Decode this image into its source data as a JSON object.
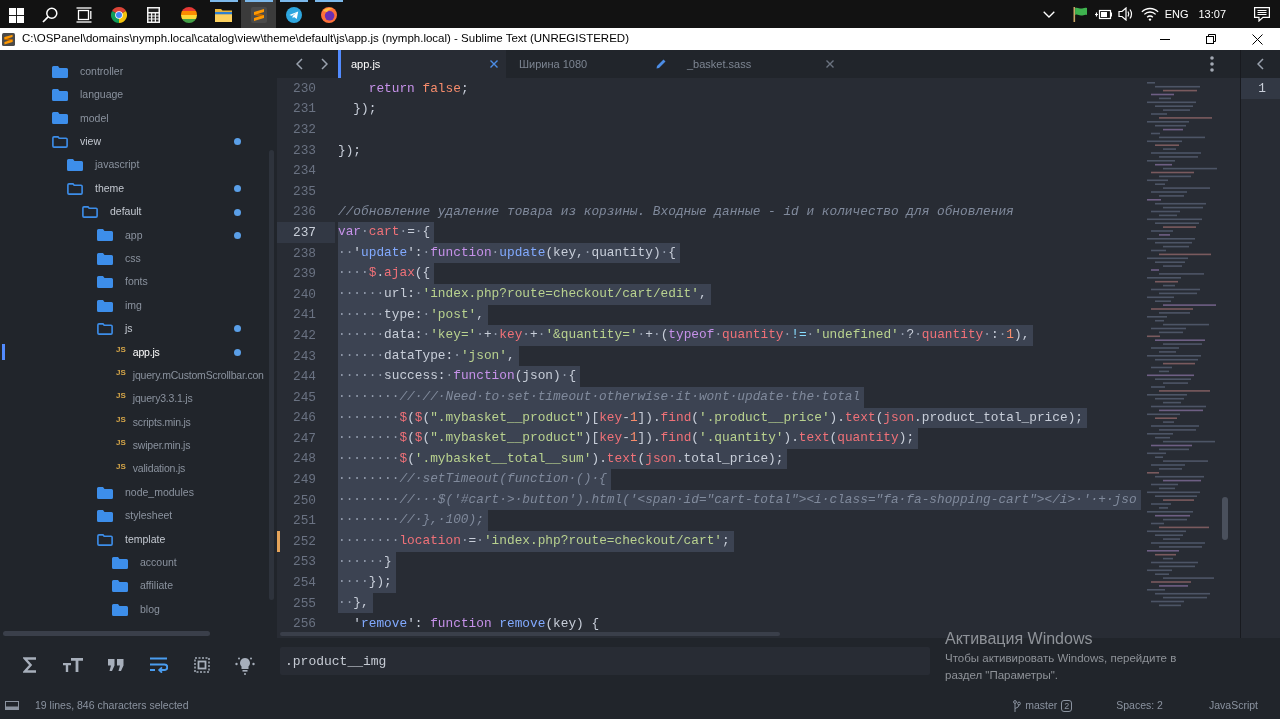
{
  "taskbar": {
    "apps": [
      {
        "kind": "start",
        "running": false,
        "active": false
      },
      {
        "kind": "search",
        "running": false,
        "active": false
      },
      {
        "kind": "task-view",
        "running": false,
        "active": false
      },
      {
        "kind": "color-wheel",
        "running": false,
        "active": false
      },
      {
        "kind": "calculator",
        "running": false,
        "active": false
      },
      {
        "kind": "striped-ball",
        "running": false,
        "active": false
      },
      {
        "kind": "folder",
        "running": true,
        "active": false
      },
      {
        "kind": "stripes-logo",
        "running": true,
        "active": true
      },
      {
        "kind": "paper-plane",
        "running": true,
        "active": false
      },
      {
        "kind": "globe",
        "running": true,
        "active": false
      }
    ],
    "language": "ENG",
    "time": "13:07"
  },
  "window": {
    "title": "C:\\OSPanel\\domains\\nymph.local\\catalog\\view\\theme\\default\\js\\app.js (nymph.local) - Sublime Text (UNREGISTERED)"
  },
  "sidebar": {
    "items": [
      {
        "kind": "folder",
        "label": "controller",
        "expanded": false,
        "modified": false,
        "selected": false
      },
      {
        "kind": "folder",
        "label": "language",
        "expanded": false,
        "modified": false,
        "selected": false
      },
      {
        "kind": "folder",
        "label": "model",
        "expanded": false,
        "modified": false,
        "selected": false
      },
      {
        "kind": "folder",
        "label": "view",
        "expanded": true,
        "modified": true,
        "selected": false,
        "children": [
          {
            "kind": "folder",
            "label": "javascript",
            "expanded": false,
            "modified": false,
            "selected": false
          },
          {
            "kind": "folder",
            "label": "theme",
            "expanded": true,
            "modified": true,
            "selected": false,
            "children": [
              {
                "kind": "folder",
                "label": "default",
                "expanded": true,
                "modified": true,
                "selected": false,
                "children": [
                  {
                    "kind": "folder",
                    "label": "app",
                    "expanded": false,
                    "modified": true,
                    "selected": false
                  },
                  {
                    "kind": "folder",
                    "label": "css",
                    "expanded": false,
                    "modified": false,
                    "selected": false
                  },
                  {
                    "kind": "folder",
                    "label": "fonts",
                    "expanded": false,
                    "modified": false,
                    "selected": false
                  },
                  {
                    "kind": "folder",
                    "label": "img",
                    "expanded": false,
                    "modified": false,
                    "selected": false
                  },
                  {
                    "kind": "folder",
                    "label": "js",
                    "expanded": true,
                    "modified": true,
                    "selected": false,
                    "children": [
                      {
                        "kind": "file",
                        "badge": "JS",
                        "label": "app.js",
                        "modified": true,
                        "selected": true
                      },
                      {
                        "kind": "file",
                        "badge": "JS",
                        "label": "jquery.mCustomScrollbar.con",
                        "modified": false,
                        "selected": false
                      },
                      {
                        "kind": "file",
                        "badge": "JS",
                        "label": "jquery3.3.1.js",
                        "modified": false,
                        "selected": false
                      },
                      {
                        "kind": "file",
                        "badge": "JS",
                        "label": "scripts.min.js",
                        "modified": false,
                        "selected": false
                      },
                      {
                        "kind": "file",
                        "badge": "JS",
                        "label": "swiper.min.js",
                        "modified": false,
                        "selected": false
                      },
                      {
                        "kind": "file",
                        "badge": "JS",
                        "label": "validation.js",
                        "modified": false,
                        "selected": false
                      }
                    ]
                  },
                  {
                    "kind": "folder",
                    "label": "node_modules",
                    "expanded": false,
                    "modified": false,
                    "selected": false
                  },
                  {
                    "kind": "folder",
                    "label": "stylesheet",
                    "expanded": false,
                    "modified": false,
                    "selected": false
                  },
                  {
                    "kind": "folder",
                    "label": "template",
                    "expanded": true,
                    "modified": false,
                    "selected": false,
                    "children": [
                      {
                        "kind": "folder",
                        "label": "account",
                        "expanded": false,
                        "modified": false,
                        "selected": false
                      },
                      {
                        "kind": "folder",
                        "label": "affiliate",
                        "expanded": false,
                        "modified": false,
                        "selected": false
                      },
                      {
                        "kind": "folder",
                        "label": "blog",
                        "expanded": false,
                        "modified": false,
                        "selected": false
                      }
                    ]
                  }
                ]
              }
            ]
          }
        ]
      }
    ]
  },
  "editor": {
    "tabs": [
      {
        "label": "app.js",
        "selected": true,
        "dirty": false
      },
      {
        "label": "Ширина 1080",
        "selected": false,
        "dirty": true
      },
      {
        "label": "_basket.sass",
        "selected": false,
        "dirty": false
      }
    ],
    "lines": [
      {
        "number": "230",
        "selected": false,
        "current": false,
        "changed": false,
        "tokens": [
          {
            "kind": "keyword",
            "text": "    return"
          },
          {
            "kind": "number",
            "text": " false"
          },
          {
            "kind": "plain",
            "text": ";"
          }
        ]
      },
      {
        "number": "231",
        "selected": false,
        "current": false,
        "changed": false,
        "tokens": [
          {
            "kind": "plain",
            "text": "  });"
          }
        ]
      },
      {
        "number": "232",
        "selected": false,
        "current": false,
        "changed": false
      },
      {
        "number": "233",
        "selected": false,
        "current": false,
        "changed": false,
        "tokens": [
          {
            "kind": "plain",
            "text": "});"
          }
        ]
      },
      {
        "number": "234",
        "selected": false,
        "current": false,
        "changed": false
      },
      {
        "number": "235",
        "selected": false,
        "current": false,
        "changed": false
      },
      {
        "number": "236",
        "selected": false,
        "current": false,
        "changed": false,
        "tokens": [
          {
            "kind": "comment",
            "text": "//обновление удаление товара из корзины. Входные данные - id и количество для обновления"
          }
        ]
      },
      {
        "number": "237",
        "selected": true,
        "current": true,
        "changed": false,
        "tokens": [
          {
            "kind": "keyword",
            "text": "var"
          },
          {
            "kind": "space",
            "text": "·"
          },
          {
            "kind": "variable",
            "text": "cart"
          },
          {
            "kind": "space",
            "text": "·"
          },
          {
            "kind": "plain",
            "text": "="
          },
          {
            "kind": "space",
            "text": "·"
          },
          {
            "kind": "plain",
            "text": "{"
          }
        ]
      },
      {
        "number": "238",
        "selected": true,
        "current": false,
        "changed": false,
        "tokens": [
          {
            "kind": "space",
            "text": "··"
          },
          {
            "kind": "plain",
            "text": "'"
          },
          {
            "kind": "key",
            "text": "update"
          },
          {
            "kind": "plain",
            "text": "':"
          },
          {
            "kind": "space",
            "text": "·"
          },
          {
            "kind": "keyword",
            "text": "function"
          },
          {
            "kind": "space",
            "text": "·"
          },
          {
            "kind": "function",
            "text": "update"
          },
          {
            "kind": "plain",
            "text": "(key,"
          },
          {
            "kind": "space",
            "text": "·"
          },
          {
            "kind": "plain",
            "text": "quantity)"
          },
          {
            "kind": "space",
            "text": "·"
          },
          {
            "kind": "plain",
            "text": "{"
          }
        ]
      },
      {
        "number": "239",
        "selected": true,
        "current": false,
        "changed": false,
        "tokens": [
          {
            "kind": "space",
            "text": "····"
          },
          {
            "kind": "variable",
            "text": "$"
          },
          {
            "kind": "plain",
            "text": "."
          },
          {
            "kind": "variable",
            "text": "ajax"
          },
          {
            "kind": "plain",
            "text": "({"
          }
        ]
      },
      {
        "number": "240",
        "selected": true,
        "current": false,
        "changed": false,
        "tokens": [
          {
            "kind": "space",
            "text": "······"
          },
          {
            "kind": "property",
            "text": "url"
          },
          {
            "kind": "plain",
            "text": ":"
          },
          {
            "kind": "space",
            "text": "·"
          },
          {
            "kind": "string",
            "text": "'index.php?route=checkout/cart/edit'"
          },
          {
            "kind": "plain",
            "text": ","
          }
        ]
      },
      {
        "number": "241",
        "selected": true,
        "current": false,
        "changed": false,
        "tokens": [
          {
            "kind": "space",
            "text": "······"
          },
          {
            "kind": "property",
            "text": "type"
          },
          {
            "kind": "plain",
            "text": ":"
          },
          {
            "kind": "space",
            "text": "·"
          },
          {
            "kind": "string",
            "text": "'post'"
          },
          {
            "kind": "plain",
            "text": ","
          }
        ]
      },
      {
        "number": "242",
        "selected": true,
        "current": false,
        "changed": false,
        "tokens": [
          {
            "kind": "space",
            "text": "······"
          },
          {
            "kind": "property",
            "text": "data"
          },
          {
            "kind": "plain",
            "text": ":"
          },
          {
            "kind": "space",
            "text": "·"
          },
          {
            "kind": "string",
            "text": "'key='"
          },
          {
            "kind": "space",
            "text": "·"
          },
          {
            "kind": "plain",
            "text": "+"
          },
          {
            "kind": "space",
            "text": "·"
          },
          {
            "kind": "variable",
            "text": "key"
          },
          {
            "kind": "space",
            "text": "·"
          },
          {
            "kind": "plain",
            "text": "+"
          },
          {
            "kind": "space",
            "text": "·"
          },
          {
            "kind": "string",
            "text": "'&quantity='"
          },
          {
            "kind": "space",
            "text": "·"
          },
          {
            "kind": "plain",
            "text": "+"
          },
          {
            "kind": "space",
            "text": "·"
          },
          {
            "kind": "plain",
            "text": "("
          },
          {
            "kind": "keyword",
            "text": "typeof"
          },
          {
            "kind": "space",
            "text": "·"
          },
          {
            "kind": "variable",
            "text": "quantity"
          },
          {
            "kind": "space",
            "text": "·"
          },
          {
            "kind": "operator",
            "text": "!="
          },
          {
            "kind": "space",
            "text": "·"
          },
          {
            "kind": "string",
            "text": "'undefined'"
          },
          {
            "kind": "space",
            "text": "·"
          },
          {
            "kind": "plain",
            "text": "?"
          },
          {
            "kind": "space",
            "text": "·"
          },
          {
            "kind": "variable",
            "text": "quantity"
          },
          {
            "kind": "space",
            "text": "·"
          },
          {
            "kind": "plain",
            "text": ":"
          },
          {
            "kind": "space",
            "text": "·"
          },
          {
            "kind": "number",
            "text": "1"
          },
          {
            "kind": "plain",
            "text": "),"
          }
        ]
      },
      {
        "number": "243",
        "selected": true,
        "current": false,
        "changed": false,
        "tokens": [
          {
            "kind": "space",
            "text": "······"
          },
          {
            "kind": "property",
            "text": "dataType"
          },
          {
            "kind": "plain",
            "text": ":"
          },
          {
            "kind": "space",
            "text": "·"
          },
          {
            "kind": "string",
            "text": "'json'"
          },
          {
            "kind": "plain",
            "text": ","
          }
        ]
      },
      {
        "number": "244",
        "selected": true,
        "current": false,
        "changed": false,
        "tokens": [
          {
            "kind": "space",
            "text": "······"
          },
          {
            "kind": "property",
            "text": "success"
          },
          {
            "kind": "plain",
            "text": ":"
          },
          {
            "kind": "space",
            "text": "·"
          },
          {
            "kind": "keyword",
            "text": "function"
          },
          {
            "kind": "plain",
            "text": "(json)"
          },
          {
            "kind": "space",
            "text": "·"
          },
          {
            "kind": "plain",
            "text": "{"
          }
        ]
      },
      {
        "number": "245",
        "selected": true,
        "current": false,
        "changed": false,
        "tokens": [
          {
            "kind": "space",
            "text": "········"
          },
          {
            "kind": "comment",
            "text": "//·//·Need·to·set·timeout·otherwise·it·wont·update·the·total"
          }
        ]
      },
      {
        "number": "246",
        "selected": true,
        "current": false,
        "changed": false,
        "tokens": [
          {
            "kind": "space",
            "text": "········"
          },
          {
            "kind": "variable",
            "text": "$"
          },
          {
            "kind": "plain",
            "text": "("
          },
          {
            "kind": "variable",
            "text": "$"
          },
          {
            "kind": "plain",
            "text": "("
          },
          {
            "kind": "string",
            "text": "\".mybasket__product\""
          },
          {
            "kind": "plain",
            "text": ")["
          },
          {
            "kind": "variable",
            "text": "key"
          },
          {
            "kind": "plain",
            "text": "-"
          },
          {
            "kind": "number",
            "text": "1"
          },
          {
            "kind": "plain",
            "text": "])."
          },
          {
            "kind": "variable",
            "text": "find"
          },
          {
            "kind": "plain",
            "text": "("
          },
          {
            "kind": "string",
            "text": "'.product__price'"
          },
          {
            "kind": "plain",
            "text": ")."
          },
          {
            "kind": "variable",
            "text": "text"
          },
          {
            "kind": "plain",
            "text": "("
          },
          {
            "kind": "variable",
            "text": "json"
          },
          {
            "kind": "plain",
            "text": ".product_total_price);"
          }
        ]
      },
      {
        "number": "247",
        "selected": true,
        "current": false,
        "changed": false,
        "tokens": [
          {
            "kind": "space",
            "text": "········"
          },
          {
            "kind": "variable",
            "text": "$"
          },
          {
            "kind": "plain",
            "text": "("
          },
          {
            "kind": "variable",
            "text": "$"
          },
          {
            "kind": "plain",
            "text": "("
          },
          {
            "kind": "string",
            "text": "\".mybasket__product\""
          },
          {
            "kind": "plain",
            "text": ")["
          },
          {
            "kind": "variable",
            "text": "key"
          },
          {
            "kind": "plain",
            "text": "-"
          },
          {
            "kind": "number",
            "text": "1"
          },
          {
            "kind": "plain",
            "text": "])."
          },
          {
            "kind": "variable",
            "text": "find"
          },
          {
            "kind": "plain",
            "text": "("
          },
          {
            "kind": "string",
            "text": "'.quantity'"
          },
          {
            "kind": "plain",
            "text": ")."
          },
          {
            "kind": "variable",
            "text": "text"
          },
          {
            "kind": "plain",
            "text": "("
          },
          {
            "kind": "variable",
            "text": "quantity"
          },
          {
            "kind": "plain",
            "text": ");"
          }
        ]
      },
      {
        "number": "248",
        "selected": true,
        "current": false,
        "changed": false,
        "tokens": [
          {
            "kind": "space",
            "text": "········"
          },
          {
            "kind": "variable",
            "text": "$"
          },
          {
            "kind": "plain",
            "text": "("
          },
          {
            "kind": "string",
            "text": "'.mybasket__total__sum'"
          },
          {
            "kind": "plain",
            "text": ")."
          },
          {
            "kind": "variable",
            "text": "text"
          },
          {
            "kind": "plain",
            "text": "("
          },
          {
            "kind": "variable",
            "text": "json"
          },
          {
            "kind": "plain",
            "text": ".total_price);"
          }
        ]
      },
      {
        "number": "249",
        "selected": true,
        "current": false,
        "changed": false,
        "tokens": [
          {
            "kind": "space",
            "text": "········"
          },
          {
            "kind": "comment",
            "text": "//·setTimeout(function·()·{"
          }
        ]
      },
      {
        "number": "250",
        "selected": true,
        "current": false,
        "changed": false,
        "tokens": [
          {
            "kind": "space",
            "text": "········"
          },
          {
            "kind": "comment",
            "text": "//···$('#cart·>·button').html('<span·id=\"cart-total\"><i·class=\"fa·fa-shopping-cart\"></i>·'·+·jso"
          }
        ]
      },
      {
        "number": "251",
        "selected": true,
        "current": false,
        "changed": false,
        "tokens": [
          {
            "kind": "space",
            "text": "········"
          },
          {
            "kind": "comment",
            "text": "//·},·100);"
          }
        ]
      },
      {
        "number": "252",
        "selected": true,
        "current": false,
        "changed": true,
        "tokens": [
          {
            "kind": "space",
            "text": "········"
          },
          {
            "kind": "variable",
            "text": "location"
          },
          {
            "kind": "space",
            "text": "·"
          },
          {
            "kind": "plain",
            "text": "="
          },
          {
            "kind": "space",
            "text": "·"
          },
          {
            "kind": "string",
            "text": "'index.php?route=checkout/cart'"
          },
          {
            "kind": "plain",
            "text": ";"
          }
        ]
      },
      {
        "number": "253",
        "selected": true,
        "current": false,
        "changed": false,
        "tokens": [
          {
            "kind": "space",
            "text": "······"
          },
          {
            "kind": "plain",
            "text": "}"
          }
        ]
      },
      {
        "number": "254",
        "selected": true,
        "current": false,
        "changed": false,
        "tokens": [
          {
            "kind": "space",
            "text": "····"
          },
          {
            "kind": "plain",
            "text": "});"
          }
        ]
      },
      {
        "number": "255",
        "selected": true,
        "current": false,
        "changed": false,
        "tokens": [
          {
            "kind": "space",
            "text": "··"
          },
          {
            "kind": "plain",
            "text": "},"
          }
        ]
      },
      {
        "number": "256",
        "selected": false,
        "current": false,
        "changed": false,
        "tokens": [
          {
            "kind": "plain",
            "text": "  '"
          },
          {
            "kind": "key",
            "text": "remove"
          },
          {
            "kind": "plain",
            "text": "':"
          },
          {
            "kind": "keyword",
            "text": " function"
          },
          {
            "kind": "function",
            "text": " remove"
          },
          {
            "kind": "plain",
            "text": "(key) {"
          }
        ]
      }
    ]
  },
  "second_pane": {
    "lines": [
      {
        "number": "1",
        "current": true
      }
    ]
  },
  "find_panel": {
    "toggles": [
      {
        "kind": "sigma",
        "on": false
      },
      {
        "kind": "text-size",
        "on": false
      },
      {
        "kind": "quote",
        "on": false
      },
      {
        "kind": "wrap",
        "on": true
      },
      {
        "kind": "selection",
        "on": false
      },
      {
        "kind": "bulb",
        "on": false
      }
    ],
    "query": ".product__img"
  },
  "activation_notice": {
    "title": "Активация Windows",
    "message": "Чтобы активировать Windows, перейдите в раздел \"Параметры\"."
  },
  "status_bar": {
    "selection": "19 lines, 846 characters selected",
    "branch": "master",
    "branch_count": "2",
    "indentation": "Spaces: 2",
    "syntax": "JavaScript"
  }
}
